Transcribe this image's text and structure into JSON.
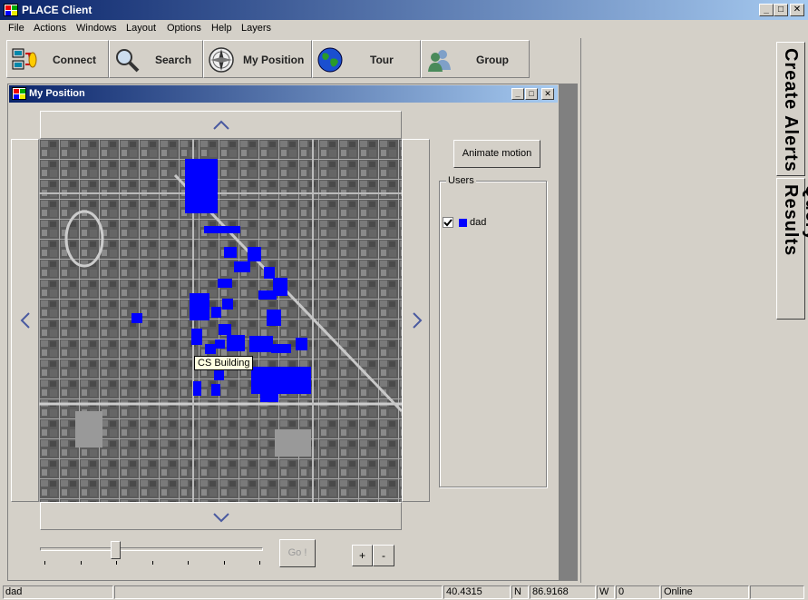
{
  "app": {
    "title": "PLACE Client",
    "window_buttons": {
      "minimize": "_",
      "maximize": "□",
      "close": "✕"
    }
  },
  "menu": [
    "File",
    "Actions",
    "Windows",
    "Layout",
    "Options",
    "Help",
    "Layers"
  ],
  "toolbar": {
    "buttons": [
      {
        "label": "Connect",
        "icon": "connect-icon"
      },
      {
        "label": "Search",
        "icon": "magnifier-icon"
      },
      {
        "label": "My Position",
        "icon": "compass-icon"
      },
      {
        "label": "Tour",
        "icon": "globe-icon"
      },
      {
        "label": "Group",
        "icon": "users-icon"
      }
    ]
  },
  "side_tabs": [
    "Create Alerts",
    "Query Results"
  ],
  "child_window": {
    "title": "My Position",
    "window_buttons": {
      "minimize": "_",
      "maximize": "□",
      "close": "✕"
    }
  },
  "map": {
    "tooltip": "CS Building",
    "building_color": "#0000ff"
  },
  "controls": {
    "animate_label": "Animate motion",
    "go_label": "Go !",
    "zoom_in": "+",
    "zoom_out": "-"
  },
  "users_group": {
    "title": "Users",
    "users": [
      {
        "name": "dad",
        "checked": true,
        "color": "#0000ff"
      }
    ]
  },
  "status": {
    "user": "dad",
    "latitude": "40.4315",
    "lat_dir": "N",
    "longitude": "86.9168",
    "lon_dir": "W",
    "count": "0",
    "connection": "Online"
  }
}
